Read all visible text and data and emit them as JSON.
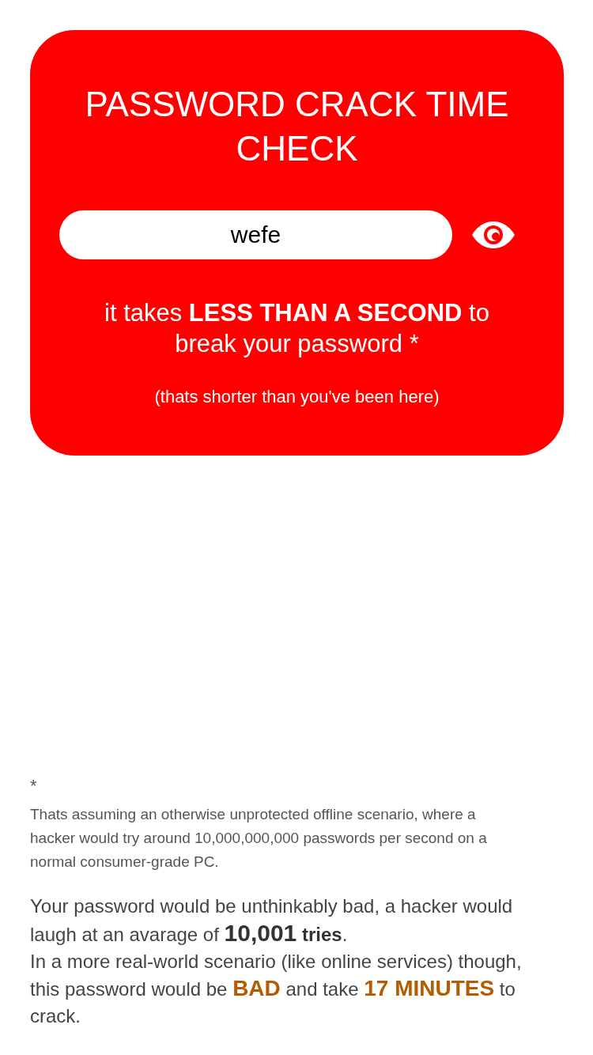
{
  "card": {
    "title": "PASSWORD CRACK TIME CHECK",
    "password": {
      "value": "wefe",
      "show_password": true
    },
    "result": "it takes **LESS THAN A SECOND** to break your password *",
    "note": "(thats shorter than you've been here)"
  },
  "footnote": {
    "mark": "*",
    "text": "Thats assuming an otherwise unprotected offline scenario, where a hacker would try around 10,000,000,000 passwords per second on a normal consumer-grade PC."
  },
  "verdict": [
    "Your password would be unthinkably bad, a hacker would laugh at an avarage of **10,001** **tries**.",
    "In a more real-world scenario (like online services) though, this password would be **BAD** and take **17 MINUTES** to crack."
  ]
}
